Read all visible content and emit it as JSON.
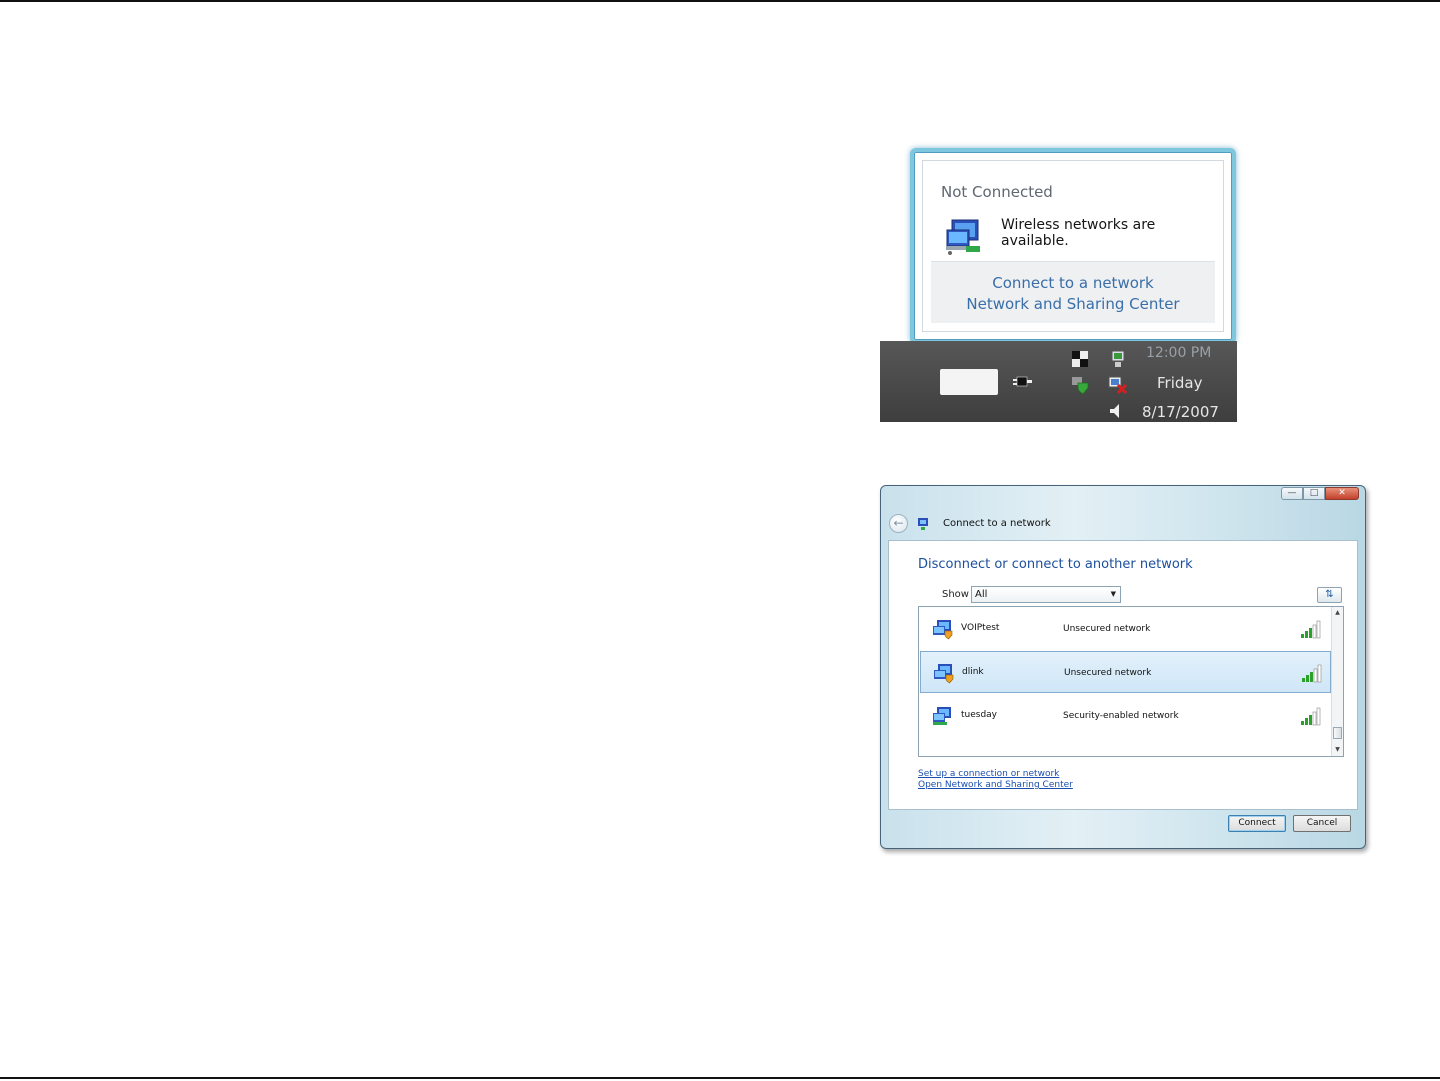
{
  "balloon": {
    "title": "Not Connected",
    "message": "Wireless networks are available.",
    "link_connect": "Connect to a network",
    "link_sharing": "Network and Sharing Center"
  },
  "taskbar": {
    "time": "12:00 PM",
    "day": "Friday",
    "date": "8/17/2007"
  },
  "window": {
    "title": "Connect to a network",
    "heading": "Disconnect or connect to another network",
    "show_label": "Show",
    "show_value": "All",
    "networks": [
      {
        "name": "VOIPtest",
        "security": "Unsecured network",
        "signal_icon": "signal-bars-icon",
        "selected": false
      },
      {
        "name": "dlink",
        "security": "Unsecured network",
        "signal_icon": "signal-bars-icon",
        "selected": true
      },
      {
        "name": "tuesday",
        "security": "Security-enabled network",
        "signal_icon": "signal-bars-icon",
        "selected": false
      }
    ],
    "link_setup": "Set up a connection or network",
    "link_open_center": "Open Network and Sharing Center",
    "connect_label": "Connect",
    "cancel_label": "Cancel"
  },
  "colors": {
    "link": "#1a4fb0",
    "heading": "#1c4f9c",
    "balloon_border": "#7fc7de",
    "taskbar": "#4a4a4a"
  }
}
